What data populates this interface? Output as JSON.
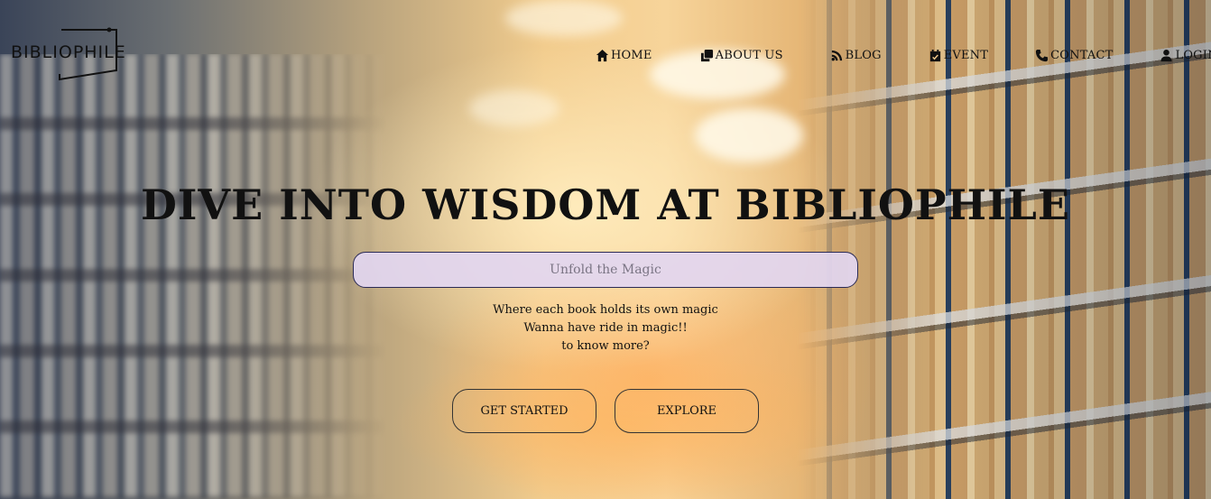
{
  "logo": {
    "text": "BIBLIOPHILE"
  },
  "nav": [
    {
      "label": "HOME",
      "icon": "home-icon"
    },
    {
      "label": "ABOUT US",
      "icon": "copy-icon"
    },
    {
      "label": "BLOG",
      "icon": "blog-icon"
    },
    {
      "label": "EVENT",
      "icon": "calendar-icon"
    },
    {
      "label": "CONTACT",
      "icon": "phone-icon"
    },
    {
      "label": "LOGIN",
      "icon": "user-icon"
    }
  ],
  "hero": {
    "title": "DIVE INTO WISDOM AT BIBLIOPHILE",
    "search_placeholder": "Unfold the Magic",
    "tagline": [
      "Where each book holds its own magic",
      "Wanna have ride in magic!!",
      "to know more?"
    ],
    "buttons": {
      "get_started": "GET STARTED",
      "explore": "EXPLORE"
    }
  },
  "colors": {
    "text": "#111111",
    "search_bg": "#E2D6F0",
    "search_border": "#2A2A55"
  }
}
